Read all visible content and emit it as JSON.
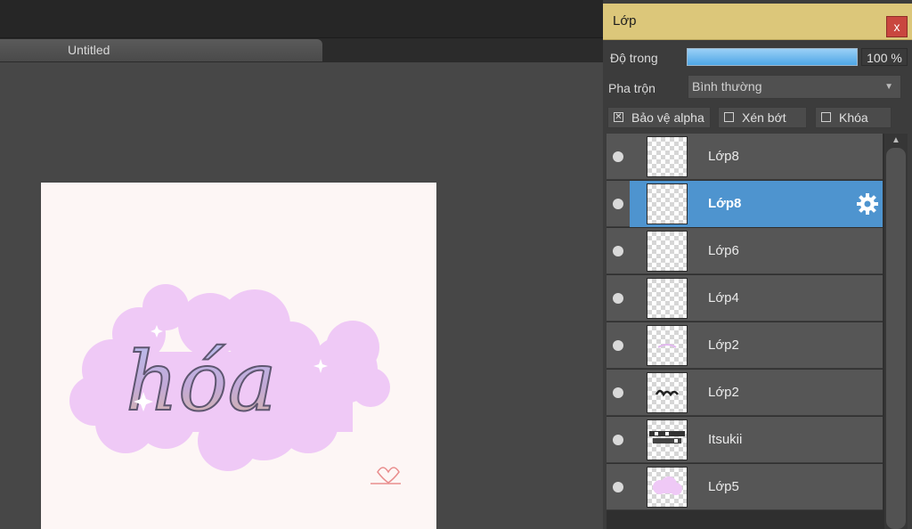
{
  "document": {
    "tab_title": "Untitled"
  },
  "layers_panel": {
    "title": "Lớp",
    "close_label": "x",
    "opacity": {
      "label": "Độ trong",
      "value": "100 %",
      "fraction": 1.0
    },
    "blend": {
      "label": "Pha trộn",
      "value": "Bình thường"
    },
    "options": [
      {
        "label": "Bảo vệ alpha",
        "checked": true
      },
      {
        "label": "Xén bớt",
        "checked": false
      },
      {
        "label": "Khóa",
        "checked": false
      }
    ],
    "layers": [
      {
        "name": "Lớp8",
        "selected": false
      },
      {
        "name": "Lớp8",
        "selected": true
      },
      {
        "name": "Lớp6",
        "selected": false
      },
      {
        "name": "Lớp4",
        "selected": false
      },
      {
        "name": "Lớp2",
        "selected": false
      },
      {
        "name": "Lớp2",
        "selected": false
      },
      {
        "name": "Itsukii",
        "selected": false
      },
      {
        "name": "Lớp5",
        "selected": false
      }
    ]
  },
  "canvas": {
    "artwork_text": "hóa",
    "cloud_color": "#efc9f6",
    "accent_color": "#4e94cf"
  }
}
